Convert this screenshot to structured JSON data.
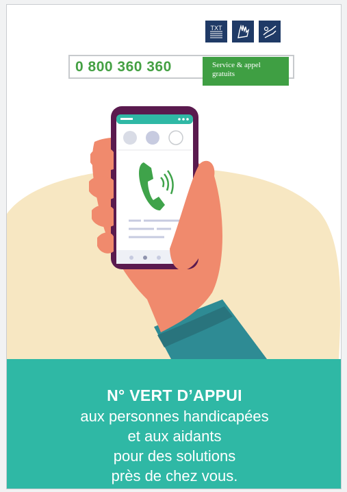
{
  "accessibility_icons": [
    {
      "icon": "txt-relay-icon",
      "label": "TXT"
    },
    {
      "icon": "sign-language-icon"
    },
    {
      "icon": "cued-speech-icon"
    }
  ],
  "phone_banner": {
    "number": "0 800 360 360",
    "service_line1": "Service & appel",
    "service_line2": "gratuits"
  },
  "headline": "N°  VERT D’APPUI",
  "subtitle_lines": [
    "aux personnes handicapées",
    "et aux aidants",
    "pour des solutions",
    "près de chez vous."
  ],
  "colors": {
    "teal": "#2fb8a5",
    "green": "#44a043",
    "navy": "#1f3a66",
    "cream": "#f7e7c2",
    "skin": "#f08a6d",
    "phone_frame": "#5a1a4e"
  }
}
